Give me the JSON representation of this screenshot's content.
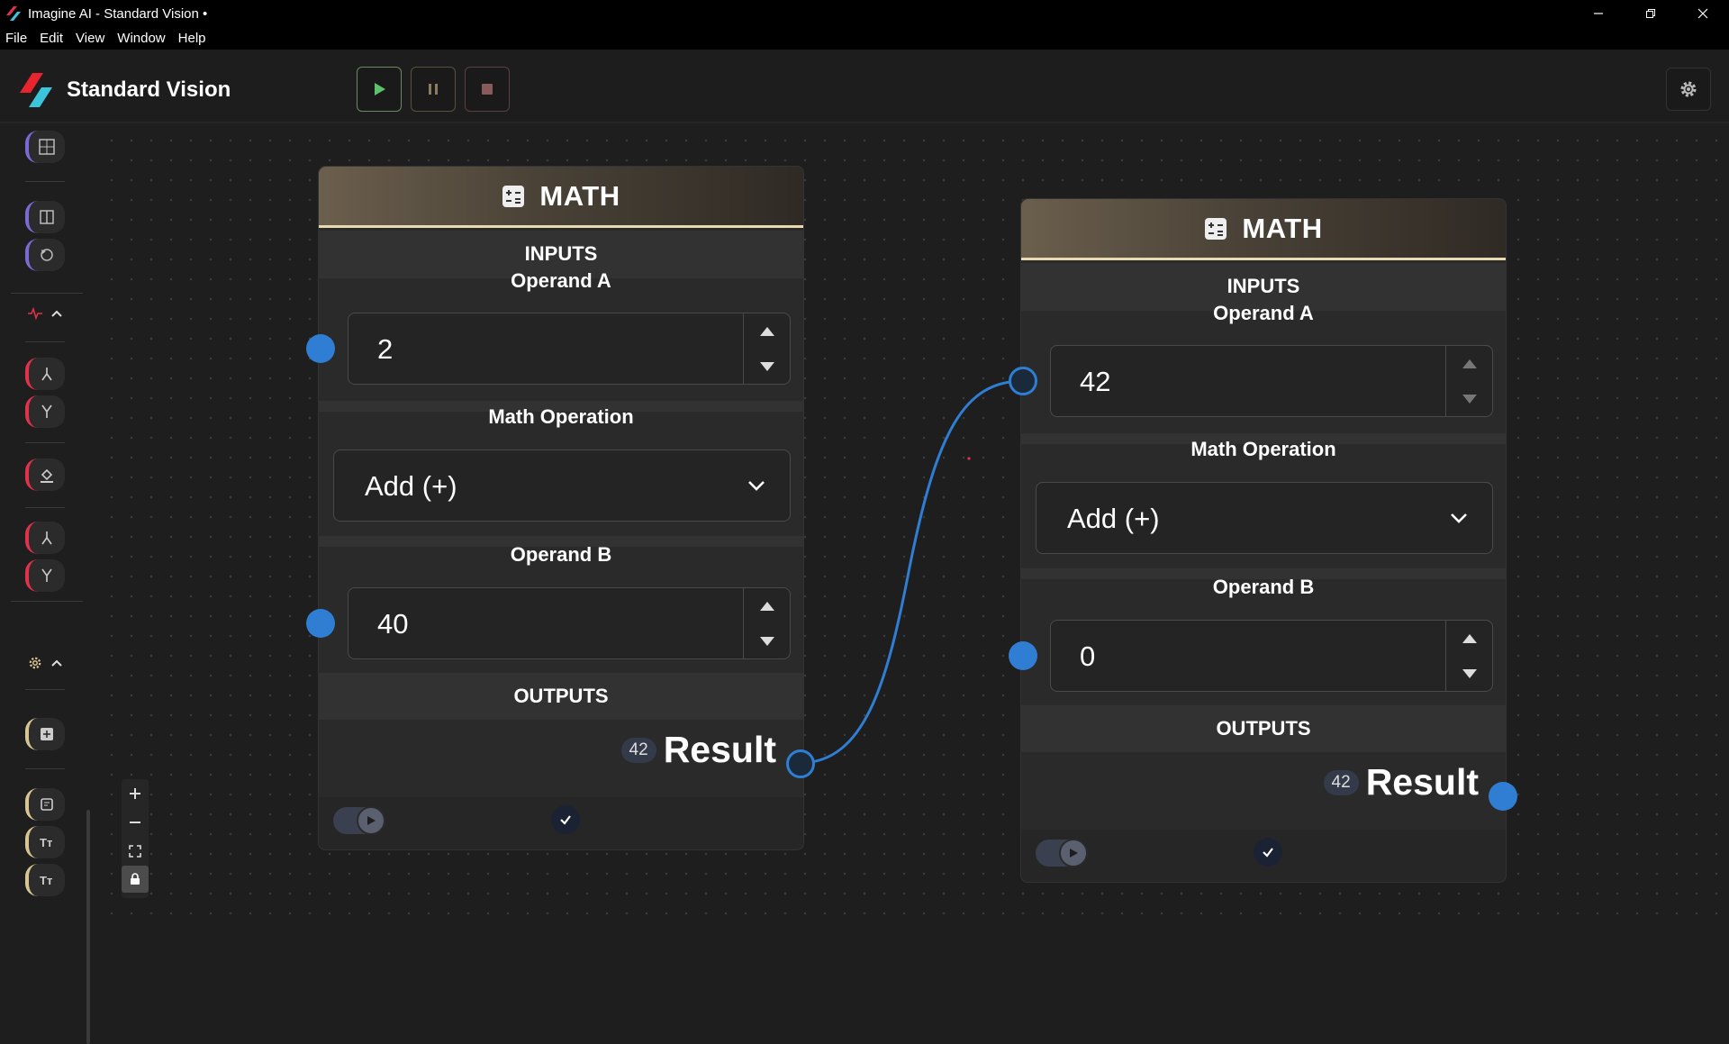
{
  "window": {
    "title": "Imagine AI - Standard Vision •"
  },
  "menu": [
    "File",
    "Edit",
    "View",
    "Window",
    "Help"
  ],
  "header": {
    "app_name": "Standard Vision"
  },
  "colors": {
    "accent_blue": "#2f7ed3",
    "node_header_border": "#e7d9b0",
    "play_green": "#5dc36a"
  },
  "nodes": [
    {
      "title": "MATH",
      "inputs_label": "INPUTS",
      "operand_a_label": "Operand A",
      "operand_a_value": "2",
      "operation_label": "Math Operation",
      "operation_value": "Add (+)",
      "operand_b_label": "Operand B",
      "operand_b_value": "40",
      "outputs_label": "OUTPUTS",
      "result_badge": "42",
      "result_label": "Result"
    },
    {
      "title": "MATH",
      "inputs_label": "INPUTS",
      "operand_a_label": "Operand A",
      "operand_a_value": "42",
      "operation_label": "Math Operation",
      "operation_value": "Add (+)",
      "operand_b_label": "Operand B",
      "operand_b_value": "0",
      "outputs_label": "OUTPUTS",
      "result_badge": "42",
      "result_label": "Result"
    }
  ]
}
